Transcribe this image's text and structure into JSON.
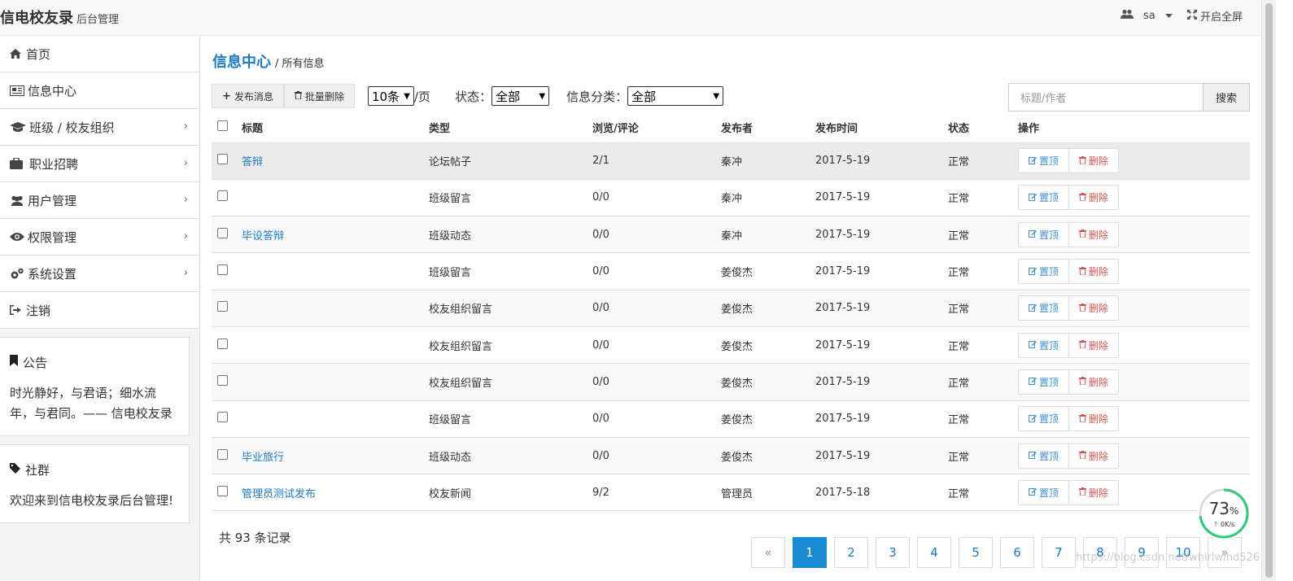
{
  "header": {
    "brand": "信电校友录",
    "brand_sub": "后台管理",
    "user": "sa",
    "fullscreen": "开启全屏"
  },
  "sidebar": {
    "items": [
      {
        "label": "首页",
        "icon": "home-icon"
      },
      {
        "label": "信息中心",
        "icon": "newspaper-icon"
      },
      {
        "label": "班级 / 校友组织",
        "icon": "graduation-cap-icon"
      },
      {
        "label": "职业招聘",
        "icon": "briefcase-icon"
      },
      {
        "label": "用户管理",
        "icon": "users-icon"
      },
      {
        "label": "权限管理",
        "icon": "eye-icon"
      },
      {
        "label": "系统设置",
        "icon": "cogs-icon"
      },
      {
        "label": "注销",
        "icon": "sign-out-icon"
      }
    ],
    "notice": {
      "title": "公告",
      "text": "时光静好，与君语；细水流年，与君同。—— 信电校友录"
    },
    "community": {
      "title": "社群",
      "text": "欢迎来到信电校友录后台管理!"
    }
  },
  "breadcrumb": {
    "title": "信息中心",
    "sep": "/ 所有信息"
  },
  "toolbar": {
    "publish": "发布消息",
    "batch_delete": "批量删除",
    "page_size": "10条",
    "per_page": "/页",
    "status_label": "状态：",
    "status_value": "全部",
    "category_label": "信息分类：",
    "category_value": "全部"
  },
  "search": {
    "placeholder": "标题/作者",
    "button": "搜索"
  },
  "table": {
    "columns": [
      "标题",
      "类型",
      "浏览/评论",
      "发布者",
      "发布时间",
      "状态",
      "操作"
    ],
    "rows": [
      {
        "title": "答辩",
        "type": "论坛帖子",
        "views": "2/1",
        "author": "秦冲",
        "date": "2017-5-19",
        "status": "正常"
      },
      {
        "title": "",
        "type": "班级留言",
        "views": "0/0",
        "author": "秦冲",
        "date": "2017-5-19",
        "status": "正常"
      },
      {
        "title": "毕设答辩",
        "type": "班级动态",
        "views": "0/0",
        "author": "秦冲",
        "date": "2017-5-19",
        "status": "正常"
      },
      {
        "title": "",
        "type": "班级留言",
        "views": "0/0",
        "author": "姜俊杰",
        "date": "2017-5-19",
        "status": "正常"
      },
      {
        "title": "",
        "type": "校友组织留言",
        "views": "0/0",
        "author": "姜俊杰",
        "date": "2017-5-19",
        "status": "正常"
      },
      {
        "title": "",
        "type": "校友组织留言",
        "views": "0/0",
        "author": "姜俊杰",
        "date": "2017-5-19",
        "status": "正常"
      },
      {
        "title": "",
        "type": "校友组织留言",
        "views": "0/0",
        "author": "姜俊杰",
        "date": "2017-5-19",
        "status": "正常"
      },
      {
        "title": "",
        "type": "班级留言",
        "views": "0/0",
        "author": "姜俊杰",
        "date": "2017-5-19",
        "status": "正常"
      },
      {
        "title": "毕业旅行",
        "type": "班级动态",
        "views": "0/0",
        "author": "姜俊杰",
        "date": "2017-5-19",
        "status": "正常"
      },
      {
        "title": "管理员测试发布",
        "type": "校友新闻",
        "views": "9/2",
        "author": "管理员",
        "date": "2017-5-18",
        "status": "正常"
      }
    ],
    "op_top": "置顶",
    "op_delete": "删除"
  },
  "footer": {
    "total": "共 93 条记录"
  },
  "pagination": {
    "prev": "«",
    "pages": [
      "1",
      "2",
      "3",
      "4",
      "5",
      "6",
      "7",
      "8",
      "9",
      "10"
    ],
    "next": "»",
    "active": "1"
  },
  "widget": {
    "percent": "73",
    "percent_unit": "%",
    "speed": "0K/s",
    "percent_value": 73
  },
  "watermark": "https://blog.csdn.net/whirlwind526",
  "colors": {
    "accent": "#1a7bc8",
    "active_page": "#1a8bd2",
    "danger": "#d9534f",
    "gauge": "#2ecc71"
  }
}
